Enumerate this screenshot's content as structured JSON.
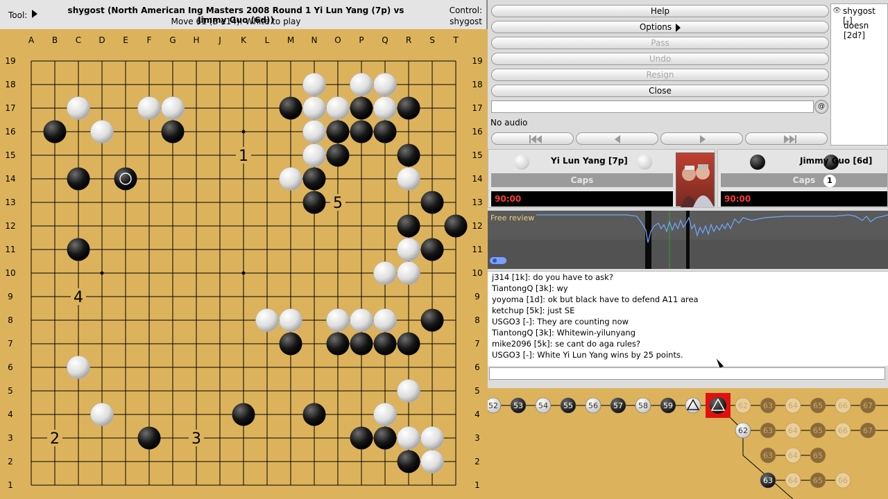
{
  "window": {
    "tool_label": "Tool:",
    "title": "shygost (North American Ing Masters 2008 Round 1 Yi Lun Yang (7p) vs Jimmy Guo (6d))",
    "move_status": "Move 61 (B e14): White to play",
    "control_label": "Control:",
    "control_value": "shygost"
  },
  "board": {
    "size": 19,
    "columns": [
      "A",
      "B",
      "C",
      "D",
      "E",
      "F",
      "G",
      "H",
      "J",
      "K",
      "L",
      "M",
      "N",
      "O",
      "P",
      "Q",
      "R",
      "S",
      "T"
    ],
    "white_stones": [
      "C17",
      "F17",
      "G17",
      "D16",
      "N18",
      "P18",
      "Q18",
      "N17",
      "O17",
      "Q17",
      "N16",
      "N15",
      "M14",
      "R14",
      "R11",
      "R10",
      "Q10",
      "L8",
      "M8",
      "O8",
      "P8",
      "Q8",
      "C6",
      "R5",
      "D4",
      "Q4",
      "R3",
      "S3",
      "S2"
    ],
    "black_stones": [
      "M17",
      "P17",
      "R17",
      "B16",
      "G16",
      "O16",
      "P16",
      "Q16",
      "O15",
      "R15",
      "C14",
      "N14",
      "N13",
      "S13",
      "R12",
      "T12",
      "C11",
      "S11",
      "S8",
      "M7",
      "O7",
      "P7",
      "Q7",
      "R7",
      "K4",
      "N4",
      "F3",
      "P3",
      "Q3",
      "R2"
    ],
    "last_move": "E14",
    "markers": [
      {
        "point": "K15",
        "label": "1"
      },
      {
        "point": "B3",
        "label": "2"
      },
      {
        "point": "H3",
        "label": "3"
      },
      {
        "point": "C9",
        "label": "4"
      },
      {
        "point": "O13",
        "label": "5"
      }
    ]
  },
  "controls": {
    "help": "Help",
    "options": "Options",
    "pass": "Pass",
    "undo": "Undo",
    "resign": "Resign",
    "close": "Close",
    "audio": "No audio"
  },
  "users": [
    "shygost [-]",
    "doesn [2d?]"
  ],
  "players": {
    "white": {
      "name": "Yi Lun Yang [7p]",
      "caps_label": "Caps",
      "clock": "90:00"
    },
    "black": {
      "name": "Jimmy Guo [6d]",
      "caps_label": "Caps",
      "captures": "1",
      "clock": "90:00"
    }
  },
  "review_label": "Free review",
  "chat": [
    "j314 [1k]: do you have to ask?",
    "TiantongQ [3k]: wy",
    "yoyoma [1d]: ok but black have to defend A11 area",
    "ketchup [5k]: just SE",
    "USGO3 [-]: They are counting now",
    "TiantongQ [3k]: Whitewin-yilunyang",
    "mike2096 [5k]: se cant do aga rules?",
    "USGO3 [-]: White Yi Lun Yang wins by 25 points."
  ],
  "tree": {
    "main_line": [
      "52",
      "53",
      "54",
      "55",
      "56",
      "57",
      "58",
      "59"
    ],
    "variation_numbers": [
      "62",
      "63",
      "64",
      "65",
      "66",
      "67"
    ],
    "colors": {
      "board": "#dcb35c",
      "highlight": "#e01010"
    }
  }
}
